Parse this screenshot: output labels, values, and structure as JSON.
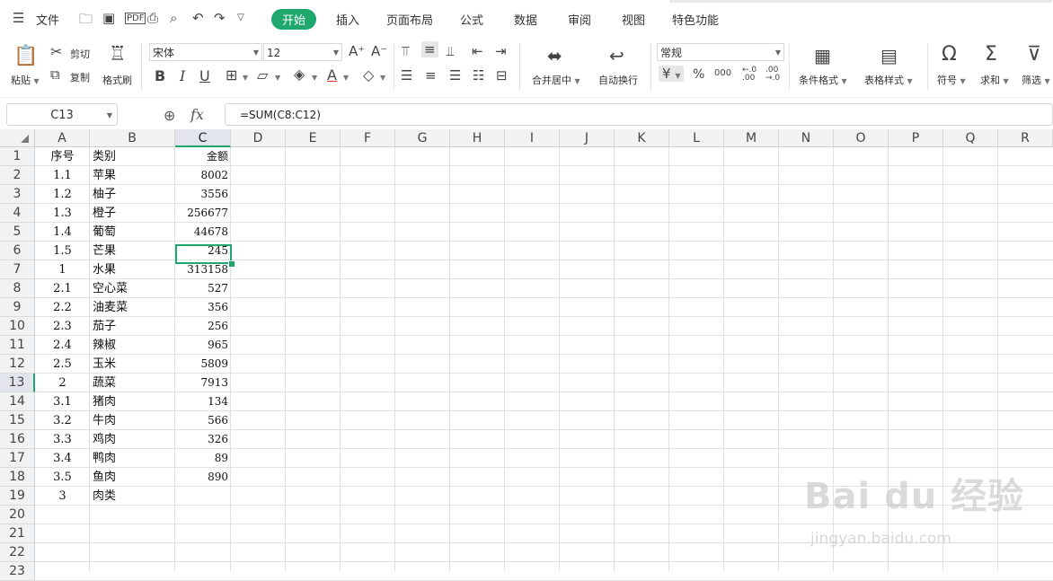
{
  "menubar": {
    "file_label": "文件",
    "tabs": [
      "开始",
      "插入",
      "页面布局",
      "公式",
      "数据",
      "审阅",
      "视图",
      "特色功能"
    ],
    "active_tab": "开始"
  },
  "ribbon": {
    "paste": "粘贴",
    "cut": "剪切",
    "copy": "复制",
    "format_painter": "格式刷",
    "font_name": "宋体",
    "font_size": "12",
    "merge_center": "合并居中",
    "wrap_text": "自动换行",
    "number_format": "常规",
    "conditional_format": "条件格式",
    "table_style": "表格样式",
    "symbol": "符号",
    "sum": "求和",
    "filter": "筛选"
  },
  "formula_bar": {
    "name_box": "C13",
    "formula": "=SUM(C8:C12)"
  },
  "columns": [
    "A",
    "B",
    "C",
    "D",
    "E",
    "F",
    "G",
    "H",
    "I",
    "J",
    "K",
    "L",
    "M",
    "N",
    "O",
    "P",
    "Q",
    "R"
  ],
  "rows": [
    {
      "n": "1",
      "a": "序号",
      "b": "类别",
      "c": "金额"
    },
    {
      "n": "2",
      "a": "1.1",
      "b": "苹果",
      "c": "8002"
    },
    {
      "n": "3",
      "a": "1.2",
      "b": "柚子",
      "c": "3556"
    },
    {
      "n": "4",
      "a": "1.3",
      "b": "橙子",
      "c": "256677"
    },
    {
      "n": "5",
      "a": "1.4",
      "b": "葡萄",
      "c": "44678"
    },
    {
      "n": "6",
      "a": "1.5",
      "b": "芒果",
      "c": "245"
    },
    {
      "n": "7",
      "a": "1",
      "b": "水果",
      "c": "313158"
    },
    {
      "n": "8",
      "a": "2.1",
      "b": "空心菜",
      "c": "527"
    },
    {
      "n": "9",
      "a": "2.2",
      "b": "油麦菜",
      "c": "356"
    },
    {
      "n": "10",
      "a": "2.3",
      "b": "茄子",
      "c": "256"
    },
    {
      "n": "11",
      "a": "2.4",
      "b": "辣椒",
      "c": "965"
    },
    {
      "n": "12",
      "a": "2.5",
      "b": "玉米",
      "c": "5809"
    },
    {
      "n": "13",
      "a": "2",
      "b": "蔬菜",
      "c": "7913"
    },
    {
      "n": "14",
      "a": "3.1",
      "b": "猪肉",
      "c": "134"
    },
    {
      "n": "15",
      "a": "3.2",
      "b": "牛肉",
      "c": "566"
    },
    {
      "n": "16",
      "a": "3.3",
      "b": "鸡肉",
      "c": "326"
    },
    {
      "n": "17",
      "a": "3.4",
      "b": "鸭肉",
      "c": "89"
    },
    {
      "n": "18",
      "a": "3.5",
      "b": "鱼肉",
      "c": "890"
    },
    {
      "n": "19",
      "a": "3",
      "b": "肉类",
      "c": ""
    },
    {
      "n": "20",
      "a": "",
      "b": "",
      "c": ""
    },
    {
      "n": "21",
      "a": "",
      "b": "",
      "c": ""
    },
    {
      "n": "22",
      "a": "",
      "b": "",
      "c": ""
    },
    {
      "n": "23",
      "a": "",
      "b": "",
      "c": ""
    }
  ],
  "watermark": {
    "main": "Bai du 经验",
    "sub": "jingyan.baidu.com"
  },
  "colors": {
    "accent": "#1fa86e"
  }
}
